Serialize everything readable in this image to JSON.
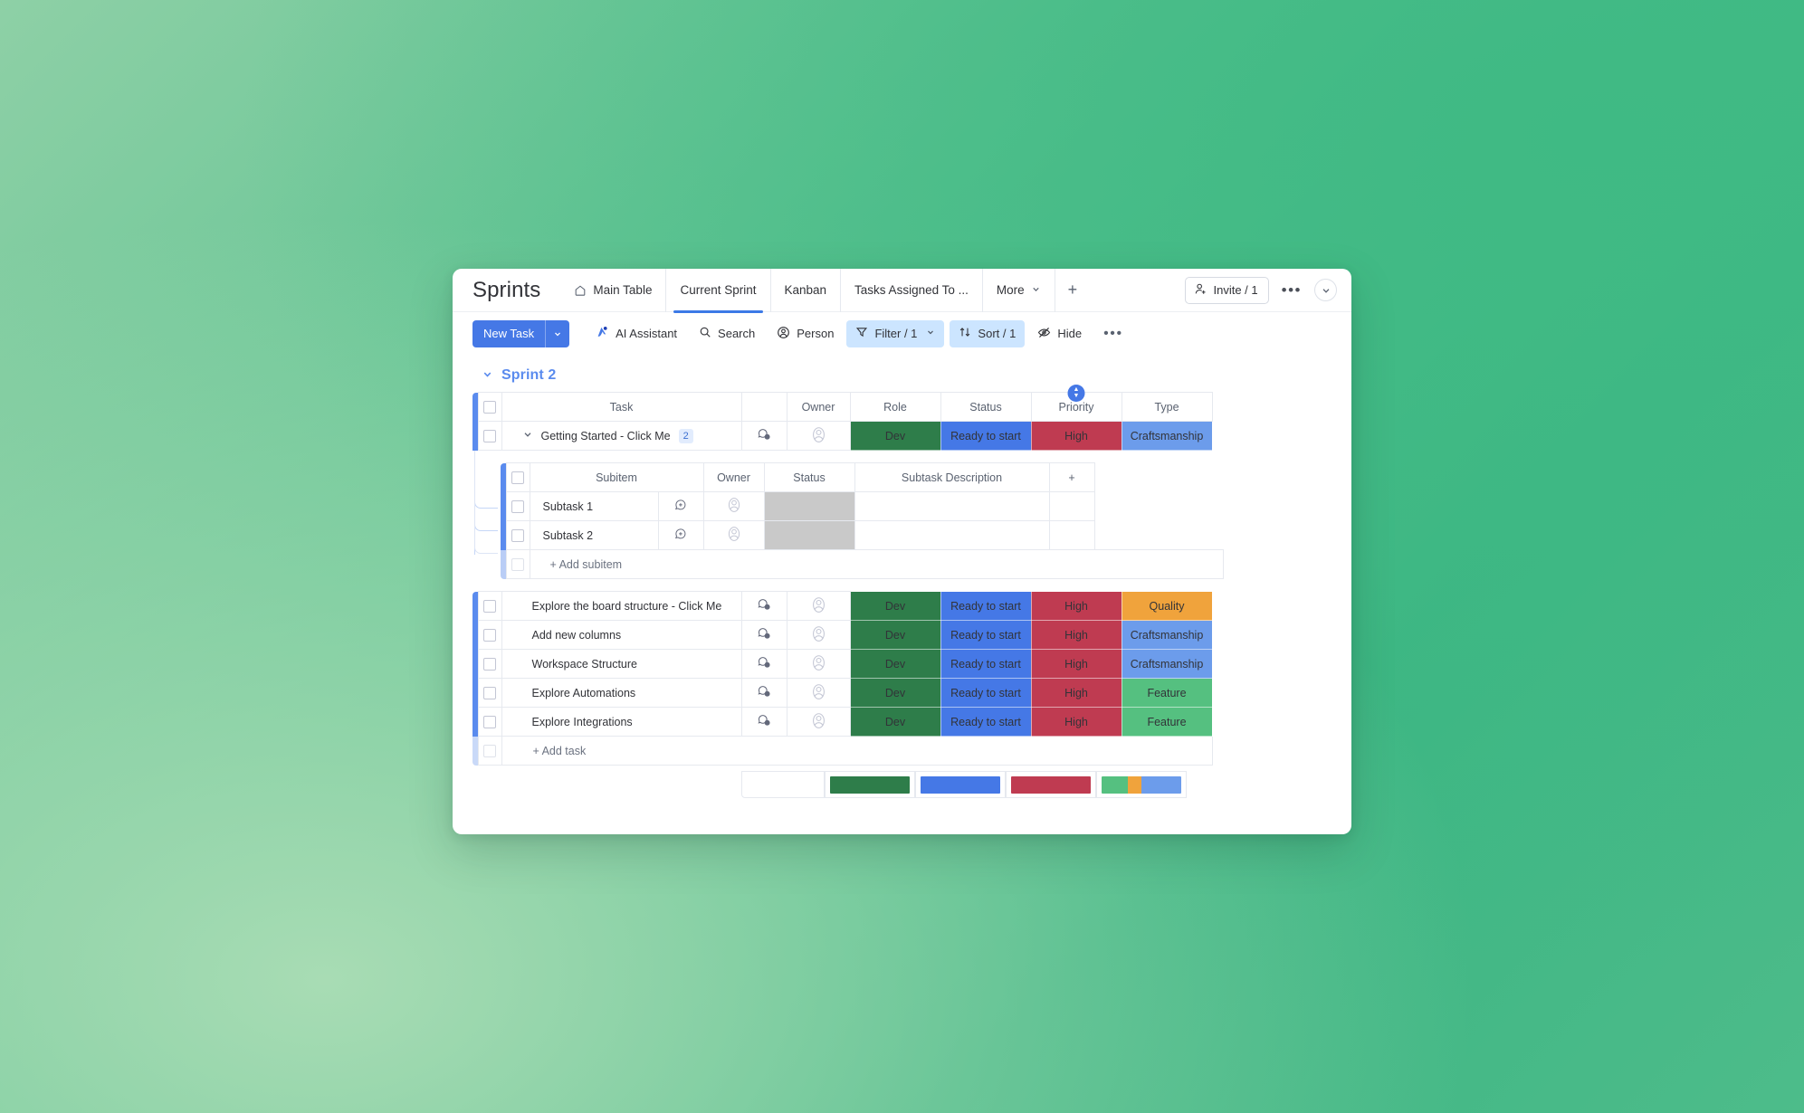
{
  "board": {
    "title": "Sprints",
    "tabs": [
      {
        "label": "Main Table",
        "icon": "home-icon",
        "active": false
      },
      {
        "label": "Current Sprint",
        "icon": "",
        "active": true
      },
      {
        "label": "Kanban",
        "icon": "",
        "active": false
      },
      {
        "label": "Tasks Assigned To ...",
        "icon": "",
        "active": false
      },
      {
        "label": "More",
        "icon": "chevron-down-icon",
        "active": false
      }
    ],
    "add_tab_label": "+",
    "invite_label": "Invite / 1",
    "more_options_label": "•••"
  },
  "toolbar": {
    "new_task_label": "New Task",
    "ai_assistant_label": "AI Assistant",
    "search_label": "Search",
    "person_label": "Person",
    "filter_label": "Filter / 1",
    "sort_label": "Sort / 1",
    "hide_label": "Hide",
    "overflow_label": "•••"
  },
  "group": {
    "title": "Sprint 2",
    "collapsed": false
  },
  "table": {
    "columns": [
      "Task",
      "Owner",
      "Role",
      "Status",
      "Priority",
      "Type"
    ],
    "priority_sorted": true,
    "rows": [
      {
        "task": "Getting Started - Click Me",
        "subitem_count": "2",
        "updates": "0",
        "role": "Dev",
        "status": "Ready to start",
        "priority": "High",
        "type": "Craftsmanship",
        "expanded": true
      },
      {
        "task": "Explore the board structure - Click Me",
        "subitem_count": "",
        "updates": "0",
        "role": "Dev",
        "status": "Ready to start",
        "priority": "High",
        "type": "Quality",
        "expanded": false
      },
      {
        "task": "Add new columns",
        "subitem_count": "",
        "updates": "0",
        "role": "Dev",
        "status": "Ready to start",
        "priority": "High",
        "type": "Craftsmanship",
        "expanded": false
      },
      {
        "task": "Workspace Structure",
        "subitem_count": "",
        "updates": "0",
        "role": "Dev",
        "status": "Ready to start",
        "priority": "High",
        "type": "Craftsmanship",
        "expanded": false
      },
      {
        "task": "Explore Automations",
        "subitem_count": "",
        "updates": "0",
        "role": "Dev",
        "status": "Ready to start",
        "priority": "High",
        "type": "Feature",
        "expanded": false
      },
      {
        "task": "Explore Integrations",
        "subitem_count": "",
        "updates": "0",
        "role": "Dev",
        "status": "Ready to start",
        "priority": "High",
        "type": "Feature",
        "expanded": false
      }
    ],
    "add_task_label": "+ Add task"
  },
  "subitems": {
    "columns": [
      "Subitem",
      "Owner",
      "Status",
      "Subtask Description"
    ],
    "add_column_label": "+",
    "rows": [
      {
        "name": "Subtask 1",
        "status": "",
        "description": ""
      },
      {
        "name": "Subtask 2",
        "status": "",
        "description": ""
      }
    ],
    "add_subitem_label": "+ Add subitem"
  },
  "summary": {
    "role": [
      {
        "color": "#2e7d4a",
        "pct": 100
      }
    ],
    "status": [
      {
        "color": "#4578e6",
        "pct": 100
      }
    ],
    "priority": [
      {
        "color": "#bf3b51",
        "pct": 100
      }
    ],
    "type": [
      {
        "color": "#55c080",
        "pct": 33
      },
      {
        "color": "#f0a33c",
        "pct": 17
      },
      {
        "color": "#6c9ceb",
        "pct": 50
      }
    ]
  },
  "colors": {
    "role_dev": "#2e7d4a",
    "status_ready": "#4578e6",
    "priority_high": "#bf3b51",
    "type_craftsmanship": "#6c9ceb",
    "type_quality": "#f0a33c",
    "type_feature": "#55c080",
    "accent_blue": "#5a8bee",
    "primary_button": "#4578e6"
  }
}
